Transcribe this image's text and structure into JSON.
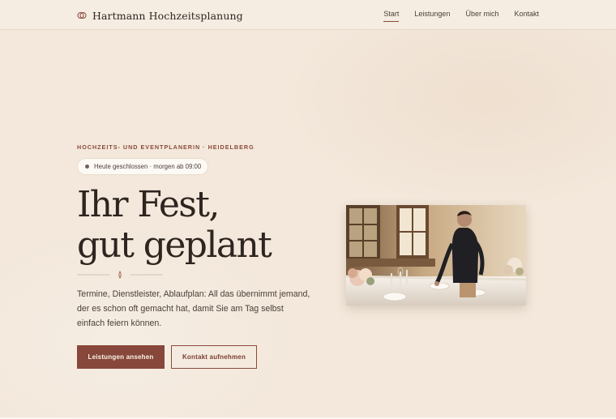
{
  "header": {
    "brand": "Hartmann Hochzeitsplanung",
    "nav": [
      {
        "label": "Start",
        "active": true
      },
      {
        "label": "Leistungen",
        "active": false
      },
      {
        "label": "Über mich",
        "active": false
      },
      {
        "label": "Kontakt",
        "active": false
      }
    ]
  },
  "hero": {
    "eyebrow": "HOCHZEITS- UND EVENTPLANERIN · HEIDELBERG",
    "status": "Heute geschlossen · morgen ab 09:00",
    "title_line1": "Ihr Fest,",
    "title_line2": "gut geplant",
    "lead": "Termine, Dienstleister, Ablaufplan: All das übernimmt jemand, der es schon oft gemacht hat, damit Sie am Tag selbst einfach feiern können.",
    "primary_button": "Leistungen ansehen",
    "secondary_button": "Kontakt aufnehmen"
  },
  "colors": {
    "background": "#f3e8db",
    "accent": "#87473a",
    "text": "#2e2520"
  },
  "icons": {
    "brand": "rings-icon",
    "status": "status-dot-icon",
    "divider": "ornament-divider-icon"
  }
}
